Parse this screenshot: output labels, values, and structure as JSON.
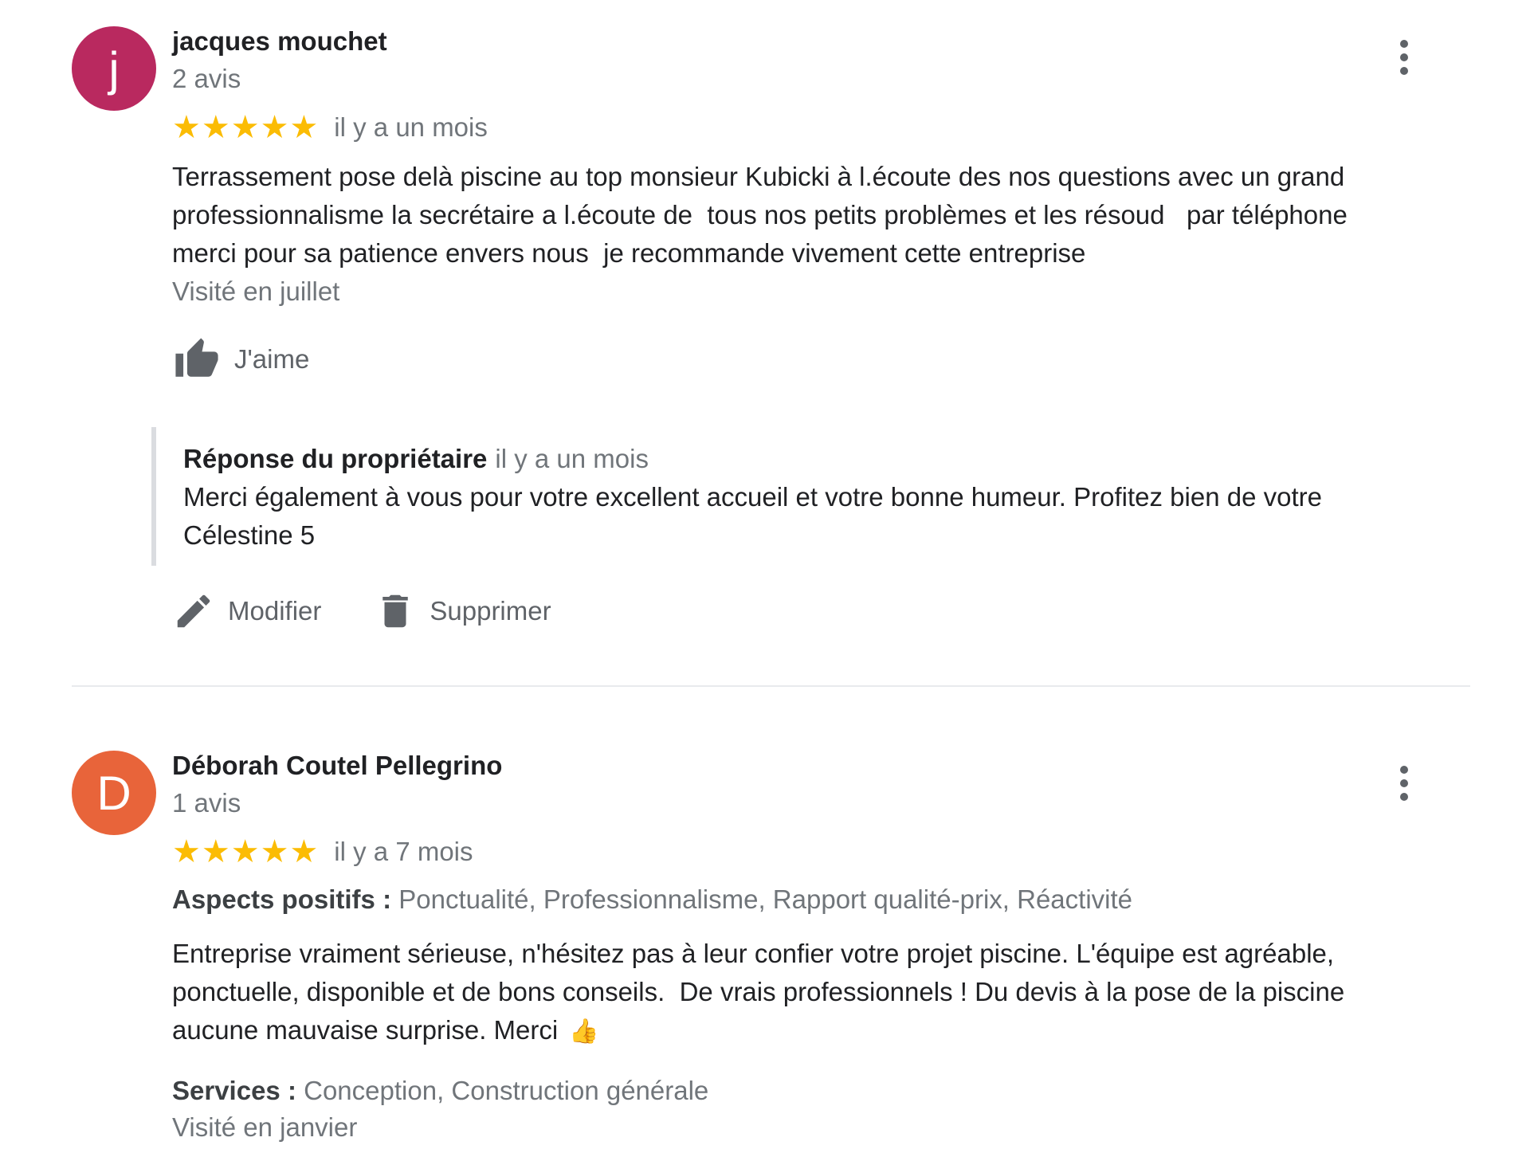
{
  "reviews": [
    {
      "author": "jacques mouchet",
      "avatar_letter": "j",
      "avatar_color": "#b9295f",
      "review_count": "2 avis",
      "rating": 5,
      "max_rating": 5,
      "date": "il y a un mois",
      "text": "Terrassement pose delà piscine au top monsieur Kubicki à l.écoute des nos questions avec un grand professionnalisme la secrétaire a l.écoute de  tous nos petits problèmes et les résoud   par téléphone merci pour sa patience envers nous  je recommande vivement cette entreprise",
      "visited": "Visité en juillet",
      "like_label": "J'aime",
      "owner_reply": {
        "title": "Réponse du propriétaire",
        "date": "il y a un mois",
        "text": "Merci également à vous pour votre excellent accueil et votre bonne humeur. Profitez bien de votre Célestine 5"
      },
      "actions": {
        "edit_label": "Modifier",
        "delete_label": "Supprimer"
      }
    },
    {
      "author": "Déborah Coutel Pellegrino",
      "avatar_letter": "D",
      "avatar_color": "#e8643a",
      "review_count": "1 avis",
      "rating": 5,
      "max_rating": 5,
      "date": "il y a 7 mois",
      "aspects_label": "Aspects positifs :",
      "aspects_value": "Ponctualité, Professionnalisme, Rapport qualité-prix, Réactivité",
      "text": "Entreprise vraiment sérieuse, n'hésitez pas à leur confier votre projet piscine. L'équipe est agréable, ponctuelle, disponible et de bons conseils.  De vrais professionnels ! Du devis à la pose de la piscine aucune mauvaise surprise. Merci",
      "emoji": "👍",
      "services_label": "Services :",
      "services_value": "Conception, Construction générale",
      "visited": "Visité en janvier"
    }
  ],
  "colors": {
    "star": "#fbbc04",
    "secondary_text": "#70757a",
    "primary_text": "#202124"
  },
  "icons": {
    "more": "more-vert-icon",
    "like": "thumb-up-icon",
    "edit": "pencil-icon",
    "delete": "trash-icon",
    "star": "star-icon"
  }
}
